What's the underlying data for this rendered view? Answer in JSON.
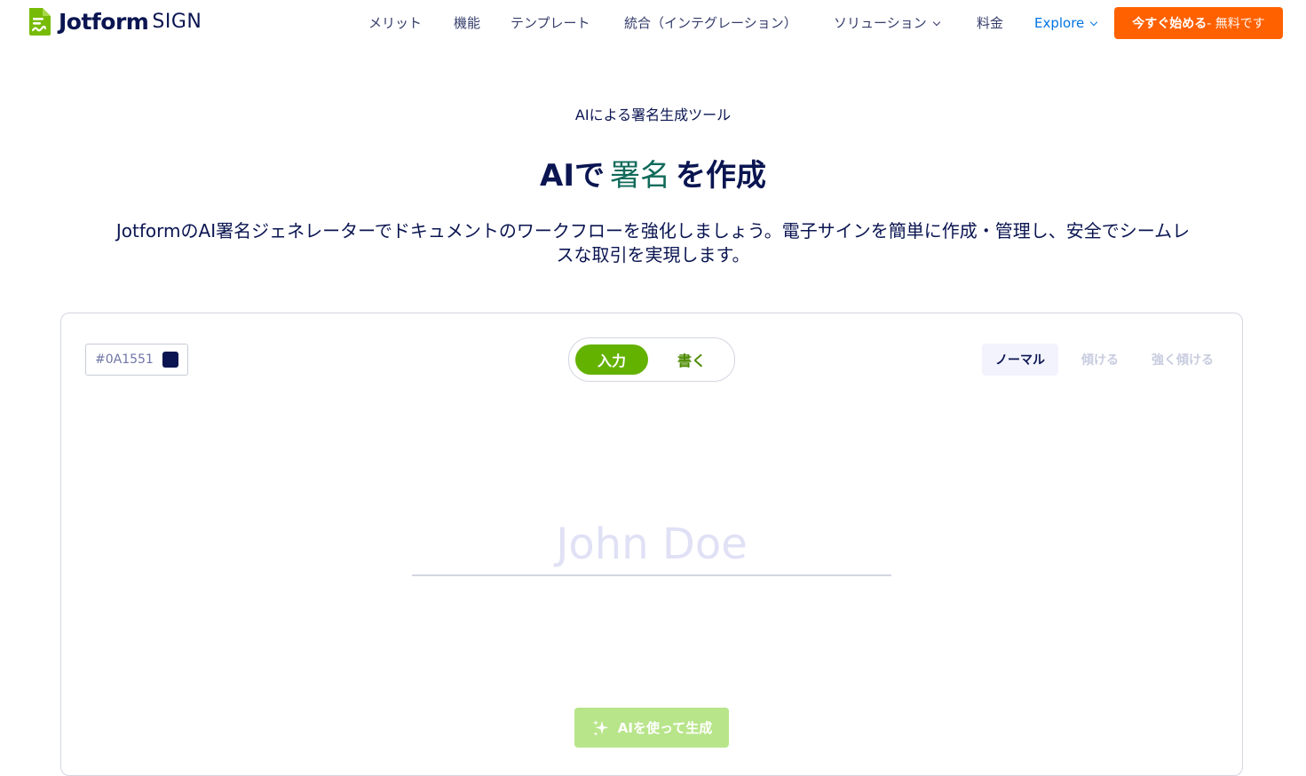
{
  "header": {
    "logo_word": "Jotform",
    "logo_sign": "SIGN",
    "nav": [
      {
        "label": "メリット",
        "dropdown": false
      },
      {
        "label": "機能",
        "dropdown": false
      },
      {
        "label": "テンプレート",
        "dropdown": false
      },
      {
        "label": "統合（インテグレーション）",
        "dropdown": false
      },
      {
        "label": "ソリューション",
        "dropdown": true
      },
      {
        "label": "料金",
        "dropdown": false
      },
      {
        "label": "Explore",
        "dropdown": true
      }
    ],
    "cta_main": "今すぐ始める",
    "cta_sub": " - 無料です"
  },
  "hero": {
    "eyebrow": "AIによる署名生成ツール",
    "headline_pre": "AIで",
    "headline_accent": "署名",
    "headline_post": "を作成",
    "lead": "JotformのAI署名ジェネレーターでドキュメントのワークフローを強化しましょう。電子サインを簡単に作成・管理し、安全でシームレスな取引を実現します。"
  },
  "card": {
    "color_hex": "#0A1551",
    "mode_type_label": "入力",
    "mode_draw_label": "書く",
    "style_normal_label": "ノーマル",
    "style_tilt_label": "傾ける",
    "style_strong_label": "強く傾ける",
    "signature_placeholder": "John Doe",
    "signature_value": "",
    "generate_label": "AIを使って生成"
  },
  "colors": {
    "brand_navy": "#0A1551",
    "cta_orange": "#FF6100",
    "toggle_green": "#64B200",
    "generate_disabled_green": "#B8E58A",
    "explore_blue": "#0075E3",
    "accent_teal": "#116B5B"
  },
  "icons": {
    "logo": "jotform-sign-logo-icon",
    "dropdown": "chevron-down-icon",
    "generate": "sparkle-icon"
  }
}
